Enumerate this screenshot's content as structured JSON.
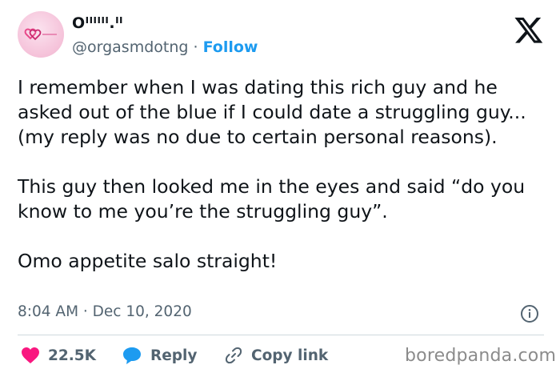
{
  "author": {
    "display_name": "Oᴵᴵᴵᴵᴵᴵ.ᴵᴵ",
    "handle": "@orgasmdotng",
    "separator": "·",
    "follow_label": "Follow"
  },
  "tweet": {
    "paragraphs": [
      "I remember when I was dating this rich guy and he asked out of the blue if I could date a struggling guy...(my reply was no due to certain personal reasons).",
      "This guy then looked me in the eyes and said “do you know to me you’re the struggling guy”.",
      "Omo appetite salo straight!"
    ],
    "timestamp": "8:04 AM · Dec 10, 2020"
  },
  "actions": {
    "likes": "22.5K",
    "reply_label": "Reply",
    "copy_label": "Copy link"
  },
  "watermark": "boredpanda.com",
  "colors": {
    "like": "#f91880",
    "reply": "#1d9bf0",
    "follow": "#1d9bf0",
    "muted": "#536471"
  },
  "icons": [
    "x-logo-icon",
    "info-icon",
    "heart-icon",
    "reply-bubble-icon",
    "link-icon"
  ]
}
